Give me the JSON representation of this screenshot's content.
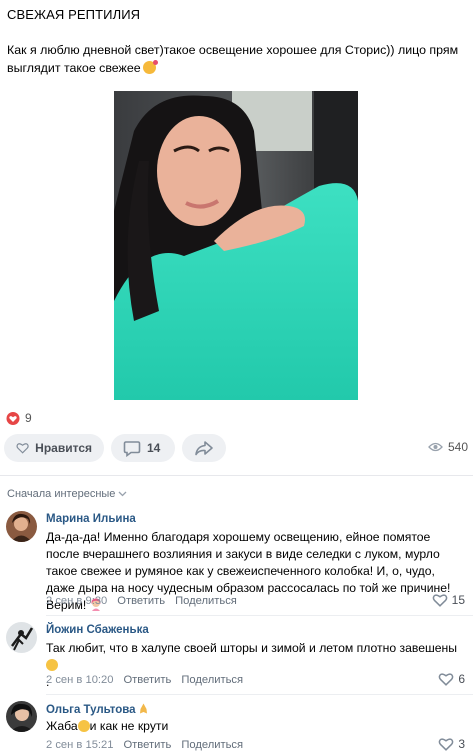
{
  "post": {
    "title": "СВЕЖАЯ РЕПТИЛИЯ",
    "text": "Как я люблю дневной свет)такое освещение хорошее для Сторис)) лицо прям выглядит такое свежее",
    "text_emoji": "smiling-face-with-hearts-emoji"
  },
  "reactions": {
    "likes_count": "9"
  },
  "actions": {
    "like_label": "Нравится",
    "comments_count": "14",
    "views_count": "540"
  },
  "comments_sort": {
    "label": "Сначала интересные"
  },
  "comments": [
    {
      "author": "Марина Ильина",
      "text": "Да-да-да! Именно благодаря хорошему освещению, ейное помятое после вчерашнего возлияния и закуси в виде селедки с луком, мурло такое свежее и румяное как у свежеиспеченного колобка! И, о, чудо, даже дыра на носу чудесным образом рассосалась по той же причине! Верим!",
      "date": "2 сен в 9:30",
      "reply_label": "Ответить",
      "share_label": "Поделиться",
      "likes": "15"
    },
    {
      "author": "Йожин Сбаженька",
      "text": "Так любит, что в халупе своей шторы и зимой и летом плотно завешены",
      "text_tail": ".",
      "date": "2 сен в 10:20",
      "reply_label": "Ответить",
      "share_label": "Поделиться",
      "likes": "6"
    },
    {
      "author": "Ольга Тультова",
      "text_before": "Жаба",
      "text_after": "и как не крути",
      "date": "2 сен в 15:21",
      "reply_label": "Ответить",
      "share_label": "Поделиться",
      "likes": "3"
    }
  ]
}
